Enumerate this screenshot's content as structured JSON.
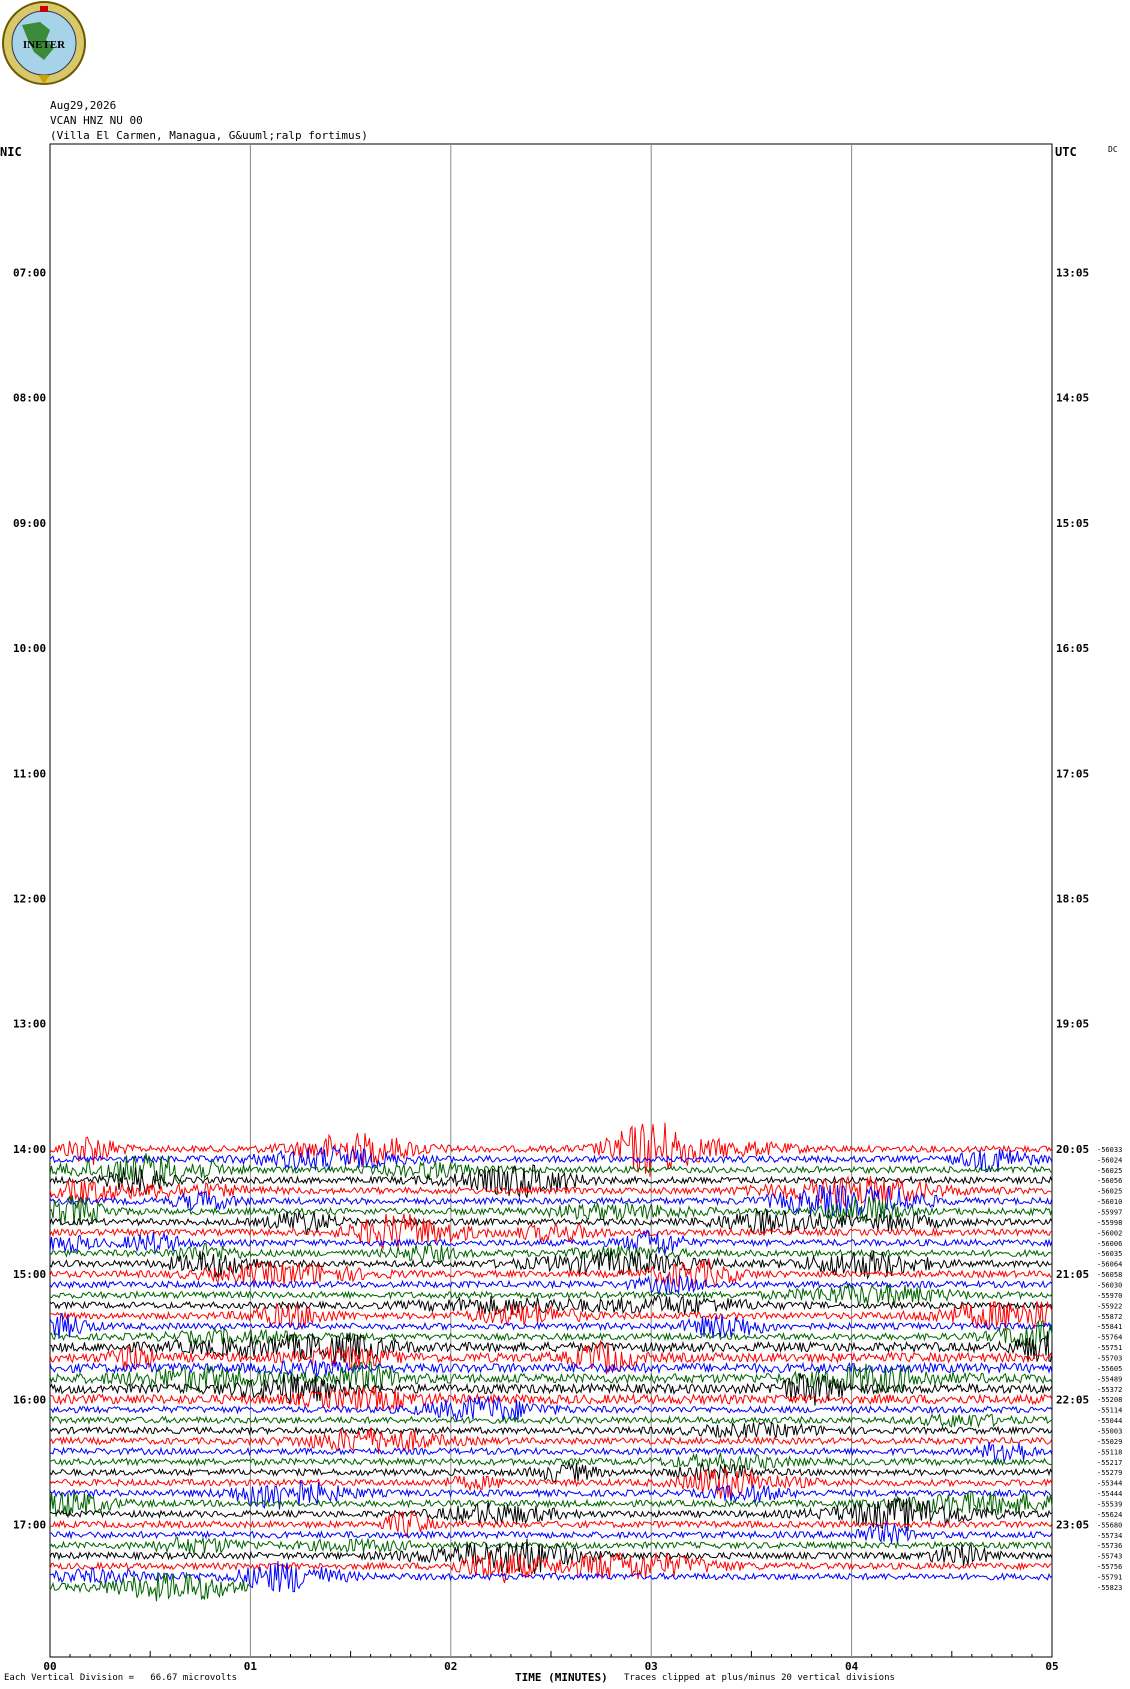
{
  "header": {
    "date": "Aug29,2026",
    "channel": "VCAN HNZ NU 00",
    "location": "(Villa El Carmen, Managua, G&uuml;ralp fortimus)"
  },
  "logo": {
    "text": "INETER"
  },
  "labels": {
    "left_zone": "NIC",
    "right_zone": "UTC",
    "dc": "DC",
    "xlabel": "TIME (MINUTES)",
    "scale_note": "Each Vertical Division =   66.67 microvolts",
    "clip_note": "Traces clipped at plus/minus 20 vertical divisions"
  },
  "chart_data": {
    "type": "line",
    "x_ticks": [
      "00",
      "01",
      "02",
      "03",
      "04",
      "05"
    ],
    "xlim": [
      0,
      5
    ],
    "left_hour_labels": [
      "07:00",
      "08:00",
      "09:00",
      "10:00",
      "11:00",
      "12:00",
      "13:00",
      "14:00",
      "15:00",
      "16:00",
      "17:00"
    ],
    "right_hour_labels": [
      "13:05",
      "14:05",
      "15:05",
      "16:05",
      "17:05",
      "18:05",
      "19:05",
      "20:05",
      "21:05",
      "22:05",
      "23:05"
    ],
    "trace_colors": [
      "#ff0000",
      "#0000ff",
      "#006400",
      "#000000"
    ],
    "traces_start_hour": "14:00",
    "last_trace_end_minute": 1.0,
    "dc_offsets": [
      "-56033",
      "-56024",
      "-56025",
      "-56056",
      "-56025",
      "-56010",
      "-55997",
      "-55998",
      "-56002",
      "-56006",
      "-56035",
      "-56064",
      "-56058",
      "-56030",
      "-55970",
      "-55922",
      "-55872",
      "-55841",
      "-55764",
      "-55751",
      "-55703",
      "-55605",
      "-55489",
      "-55372",
      "-55208",
      "-55114",
      "-55044",
      "-55003",
      "-55029",
      "-55118",
      "-55217",
      "-55279",
      "-55344",
      "-55444",
      "-55539",
      "-55624",
      "-55680",
      "-55734",
      "-55736",
      "-55743",
      "-55756",
      "-55791",
      "-55823"
    ]
  }
}
